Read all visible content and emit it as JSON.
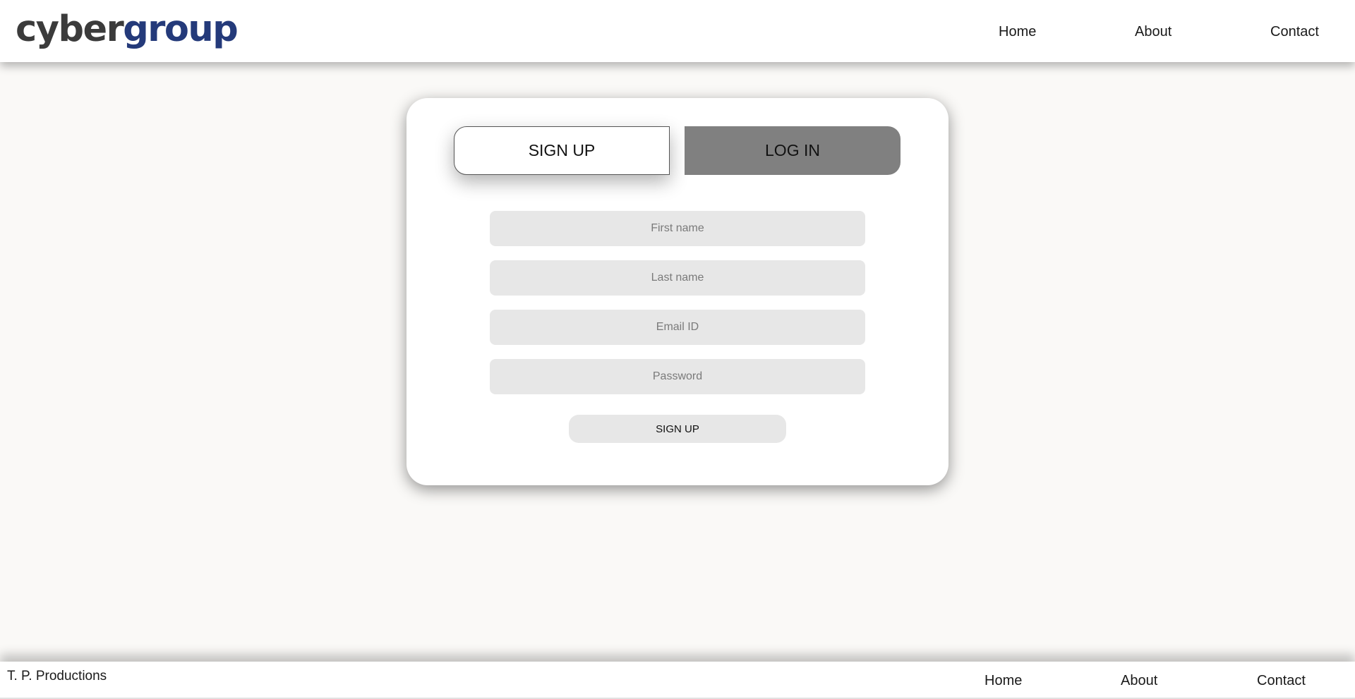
{
  "header": {
    "logo": {
      "part_a": "cyber",
      "part_b": "group"
    },
    "nav": [
      {
        "label": "Home"
      },
      {
        "label": "About"
      },
      {
        "label": "Contact"
      }
    ]
  },
  "card": {
    "tabs": [
      {
        "label": "SIGN UP",
        "active": true
      },
      {
        "label": "LOG IN",
        "active": false
      }
    ],
    "fields": [
      {
        "placeholder": "First name",
        "value": ""
      },
      {
        "placeholder": "Last name",
        "value": ""
      },
      {
        "placeholder": "Email ID",
        "value": ""
      },
      {
        "placeholder": "Password",
        "value": ""
      }
    ],
    "submit_label": "SIGN UP"
  },
  "footer": {
    "copyright": "T. P. Productions",
    "nav": [
      {
        "label": "Home"
      },
      {
        "label": "About"
      },
      {
        "label": "Contact"
      }
    ]
  },
  "colors": {
    "brand_dark": "#3b3b3b",
    "brand_blue": "#243a7a",
    "inactive_tab": "#808080",
    "field_bg": "#e7e7e7",
    "page_bg": "#faf9f7"
  }
}
